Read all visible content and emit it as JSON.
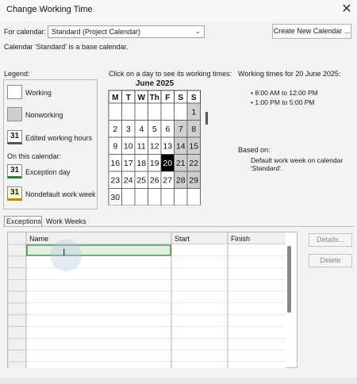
{
  "window": {
    "title": "Change Working Time"
  },
  "calendar_row": {
    "label": "For calendar:",
    "selected": "Standard (Project Calendar)",
    "create_button": "Create New Calendar ..."
  },
  "base_note": "Calendar 'Standard' is a base calendar.",
  "legend": {
    "label": "Legend:",
    "working": "Working",
    "nonworking": "Nonworking",
    "edited_number": "31",
    "edited": "Edited working hours",
    "on_this_calendar": "On this calendar:",
    "exception_number": "31",
    "exception": "Exception day",
    "nondefault_number": "31",
    "nondefault": "Nondefault work week"
  },
  "calendar_view": {
    "prompt": "Click on a day to see its working times:",
    "month": "June 2025",
    "days": [
      "M",
      "T",
      "W",
      "Th",
      "F",
      "S",
      "S"
    ],
    "weeks": [
      [
        "",
        "",
        "",
        "",
        "",
        "",
        "1"
      ],
      [
        "2",
        "3",
        "4",
        "5",
        "6",
        "7",
        "8"
      ],
      [
        "9",
        "10",
        "11",
        "12",
        "13",
        "14",
        "15"
      ],
      [
        "16",
        "17",
        "18",
        "19",
        "20",
        "21",
        "22"
      ],
      [
        "23",
        "24",
        "25",
        "26",
        "27",
        "28",
        "29"
      ],
      [
        "30",
        "",
        "",
        "",
        "",
        "",
        ""
      ]
    ],
    "selected_day": "20"
  },
  "working_times": {
    "title": "Working times for 20 June 2025:",
    "times": [
      "8:00 AM to 12:00 PM",
      "1:00 PM to 5:00 PM"
    ],
    "based_on_label": "Based on:",
    "based_on_text": "Default work week on calendar 'Standard'."
  },
  "tabs": {
    "exceptions": "Exceptions",
    "work_weeks": "Work Weeks"
  },
  "grid": {
    "columns": [
      "Name",
      "Start",
      "Finish"
    ],
    "row_count": 11
  },
  "buttons": {
    "details": "Details...",
    "delete": "Delete"
  }
}
